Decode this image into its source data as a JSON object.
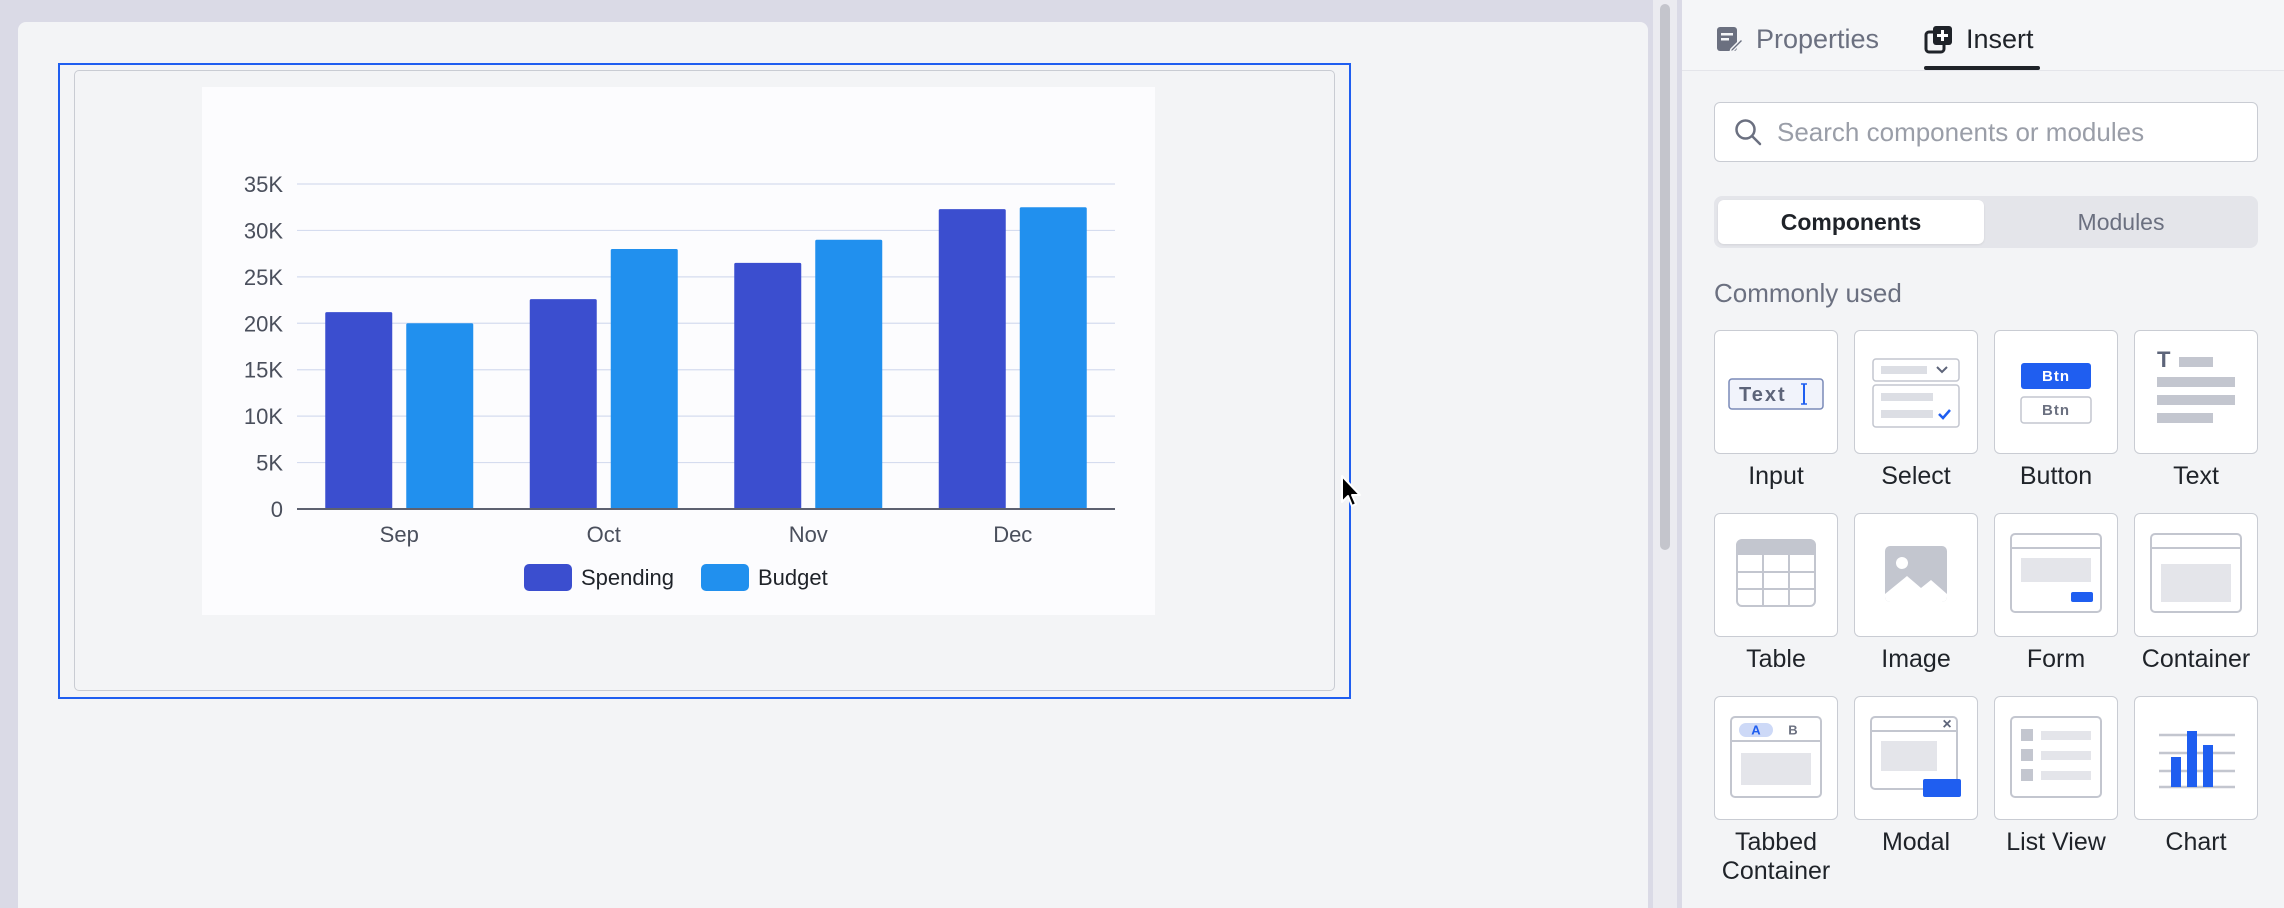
{
  "panel": {
    "tabs": [
      {
        "label": "Properties",
        "icon": "properties-icon"
      },
      {
        "label": "Insert",
        "icon": "insert-icon"
      }
    ],
    "search": {
      "placeholder": "Search components or modules"
    },
    "segments": [
      {
        "label": "Components"
      },
      {
        "label": "Modules"
      }
    ],
    "section_title": "Commonly used",
    "components": [
      {
        "label": "Input",
        "preview_text": "Text"
      },
      {
        "label": "Select"
      },
      {
        "label": "Button",
        "preview_text": "Btn"
      },
      {
        "label": "Text",
        "preview_text": "T"
      },
      {
        "label": "Table"
      },
      {
        "label": "Image"
      },
      {
        "label": "Form"
      },
      {
        "label": "Container"
      },
      {
        "label": "Tabbed Container",
        "preview_a": "A",
        "preview_b": "B"
      },
      {
        "label": "Modal",
        "preview_close": "×"
      },
      {
        "label": "List View"
      },
      {
        "label": "Chart"
      }
    ]
  },
  "colors": {
    "selection": "#1f5ef0",
    "spending": "#3b4ecf",
    "budget": "#2190ee",
    "accent": "#1f5ef0"
  },
  "chart_data": {
    "type": "bar",
    "categories": [
      "Sep",
      "Oct",
      "Nov",
      "Dec"
    ],
    "series": [
      {
        "name": "Spending",
        "values": [
          21200,
          22600,
          26500,
          32300
        ]
      },
      {
        "name": "Budget",
        "values": [
          20000,
          28000,
          29000,
          32500
        ]
      }
    ],
    "yticks": [
      "0",
      "5K",
      "10K",
      "15K",
      "20K",
      "25K",
      "30K",
      "35K"
    ],
    "ylim": [
      0,
      35000
    ],
    "grid": true,
    "legend": "bottom"
  }
}
